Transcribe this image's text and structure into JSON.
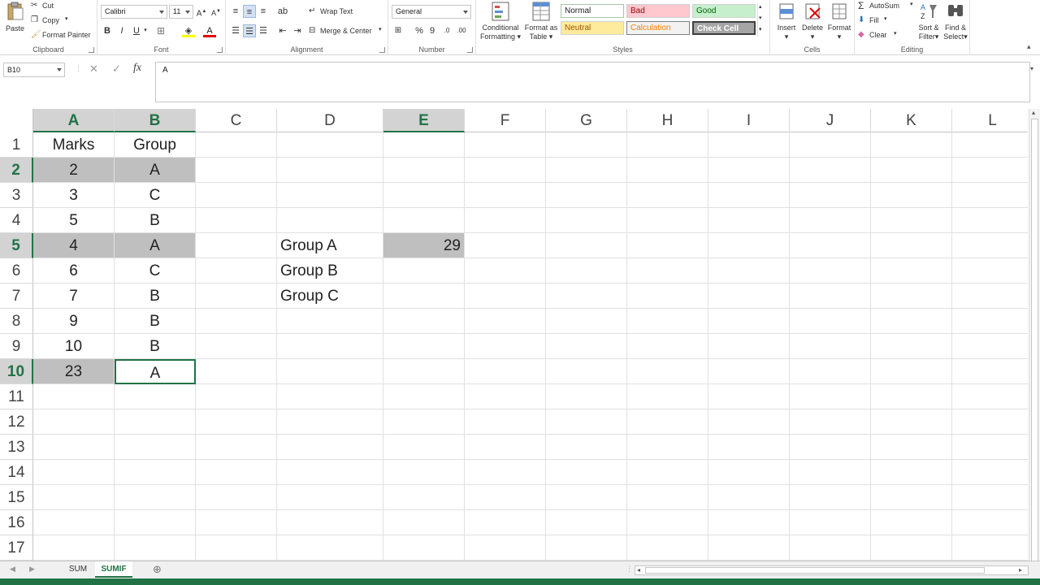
{
  "ribbon": {
    "clipboard": {
      "paste": "Paste",
      "cut": "Cut",
      "copy": "Copy",
      "format_painter": "Format Painter",
      "label": "Clipboard"
    },
    "font": {
      "family": "Calibri",
      "size": "11",
      "bold": "B",
      "italic": "I",
      "underline": "U",
      "label": "Font"
    },
    "alignment": {
      "wrap_text": "Wrap Text",
      "merge_center": "Merge & Center",
      "label": "Alignment"
    },
    "number": {
      "format": "General",
      "percent": "%",
      "comma": "9",
      "label": "Number"
    },
    "styles": {
      "conditional_formatting": [
        "Conditional",
        "Formatting"
      ],
      "format_as_table": [
        "Format as",
        "Table"
      ],
      "normal": "Normal",
      "bad": "Bad",
      "good": "Good",
      "neutral": "Neutral",
      "calculation": "Calculation",
      "check_cell": "Check Cell",
      "label": "Styles"
    },
    "cells": {
      "insert": "Insert",
      "delete": "Delete",
      "format": "Format",
      "label": "Cells"
    },
    "editing": {
      "autosum": "AutoSum",
      "fill": "Fill",
      "clear": "Clear",
      "sort_filter": [
        "Sort &",
        "Filter"
      ],
      "find_select": [
        "Find &",
        "Select"
      ],
      "label": "Editing"
    }
  },
  "formula_bar": {
    "name_box": "B10",
    "fx": "fx",
    "content": "A"
  },
  "columns": [
    "A",
    "B",
    "C",
    "D",
    "E",
    "F",
    "G",
    "H",
    "I",
    "J",
    "K",
    "L"
  ],
  "selected_columns": [
    "A",
    "B",
    "E"
  ],
  "rows": [
    "1",
    "2",
    "3",
    "4",
    "5",
    "6",
    "7",
    "8",
    "9",
    "10",
    "11",
    "12",
    "13",
    "14",
    "15",
    "16",
    "17"
  ],
  "selected_rows": [
    "2",
    "5",
    "10"
  ],
  "cells": {
    "A1": "Marks",
    "B1": "Group",
    "A2": "2",
    "B2": "A",
    "A3": "3",
    "B3": "C",
    "A4": "5",
    "B4": "B",
    "A5": "4",
    "B5": "A",
    "A6": "6",
    "B6": "C",
    "A7": "7",
    "B7": "B",
    "A8": "9",
    "B8": "B",
    "A9": "10",
    "B9": "B",
    "A10": "23",
    "B10": "A",
    "D5": "Group A",
    "E5": "29",
    "D6": "Group B",
    "D7": "Group C"
  },
  "sheets": [
    "SUM",
    "SUMIF"
  ],
  "active_sheet": "SUMIF",
  "colors": {
    "accent": "#217346",
    "highlight": "#bfbfbf"
  }
}
